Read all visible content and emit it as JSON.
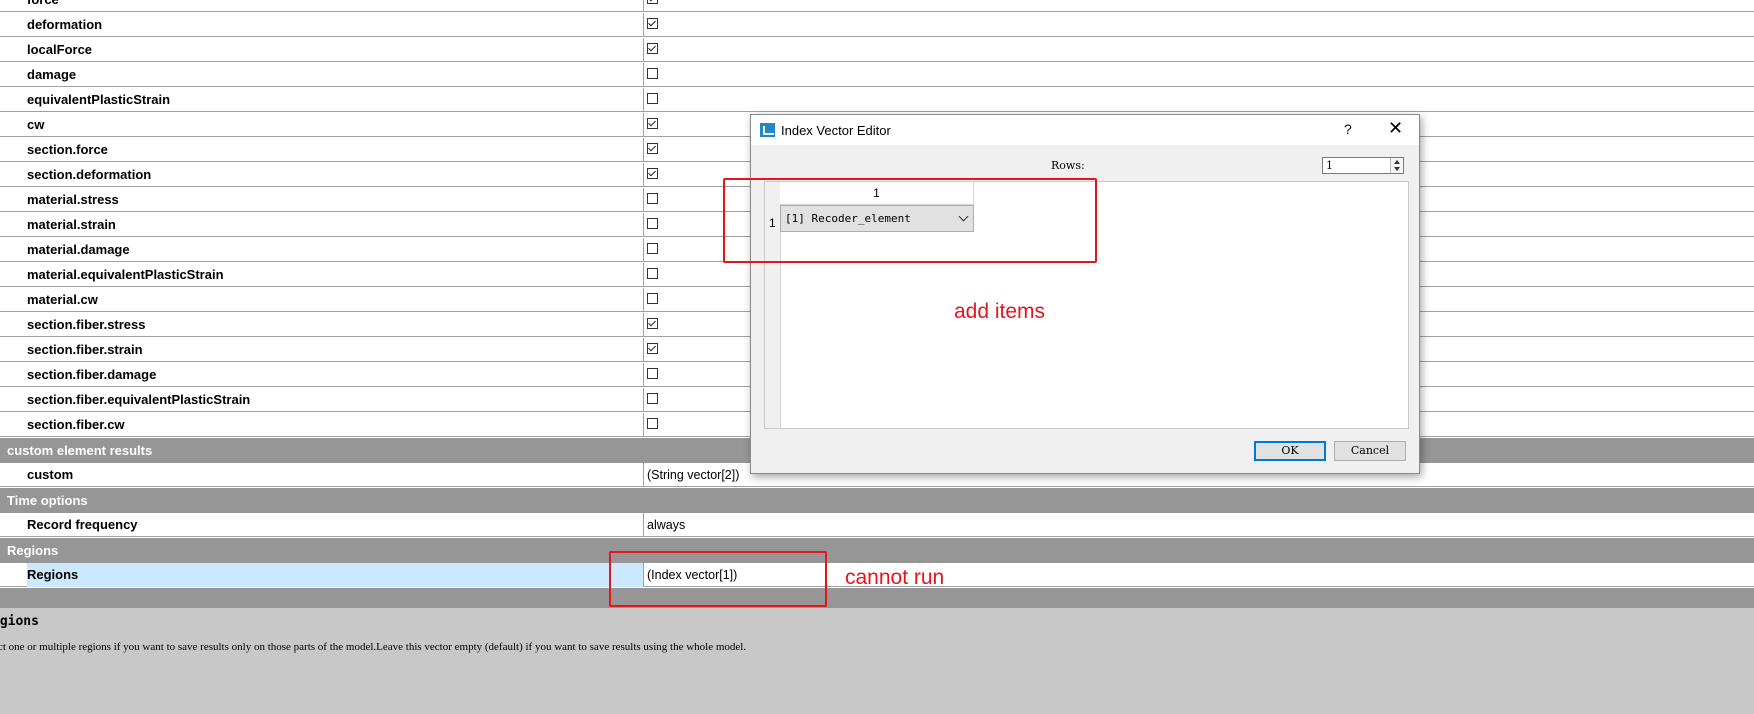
{
  "properties": {
    "rows": [
      {
        "name": "force",
        "checked": true
      },
      {
        "name": "deformation",
        "checked": true
      },
      {
        "name": "localForce",
        "checked": true
      },
      {
        "name": "damage",
        "checked": false
      },
      {
        "name": "equivalentPlasticStrain",
        "checked": false
      },
      {
        "name": "cw",
        "checked": true
      },
      {
        "name": "section.force",
        "checked": true
      },
      {
        "name": "section.deformation",
        "checked": true
      },
      {
        "name": "material.stress",
        "checked": false
      },
      {
        "name": "material.strain",
        "checked": false
      },
      {
        "name": "material.damage",
        "checked": false
      },
      {
        "name": "material.equivalentPlasticStrain",
        "checked": false
      },
      {
        "name": "material.cw",
        "checked": false
      },
      {
        "name": "section.fiber.stress",
        "checked": true
      },
      {
        "name": "section.fiber.strain",
        "checked": true
      },
      {
        "name": "section.fiber.damage",
        "checked": false
      },
      {
        "name": "section.fiber.equivalentPlasticStrain",
        "checked": false
      },
      {
        "name": "section.fiber.cw",
        "checked": false
      }
    ],
    "cat_custom": "custom element results",
    "custom_name": "custom",
    "custom_value": "(String vector[2])",
    "cat_time": "Time options",
    "record_name": "Record frequency",
    "record_value": "always",
    "cat_regions": "Regions",
    "regions_name": "Regions",
    "regions_value": "(Index vector[1])"
  },
  "description": {
    "title": "egions",
    "text": "lect one or multiple regions if you want to save results only on those parts of the model.Leave this vector empty (default) if you want to save results using the whole model."
  },
  "dialog": {
    "title": "Index Vector Editor",
    "help": "?",
    "close": "✕",
    "rows_label": "Rows:",
    "rows_value": "1",
    "col_header": "1",
    "row_header": "1",
    "combo_value": "[1] Recoder_element",
    "ok": "OK",
    "cancel": "Cancel"
  },
  "annotations": {
    "add_items": "add  items",
    "cannot_run": "cannot run"
  },
  "colors": {
    "annotation": "#e8141c",
    "category_bg": "#969696",
    "selection": "#cce8ff"
  }
}
